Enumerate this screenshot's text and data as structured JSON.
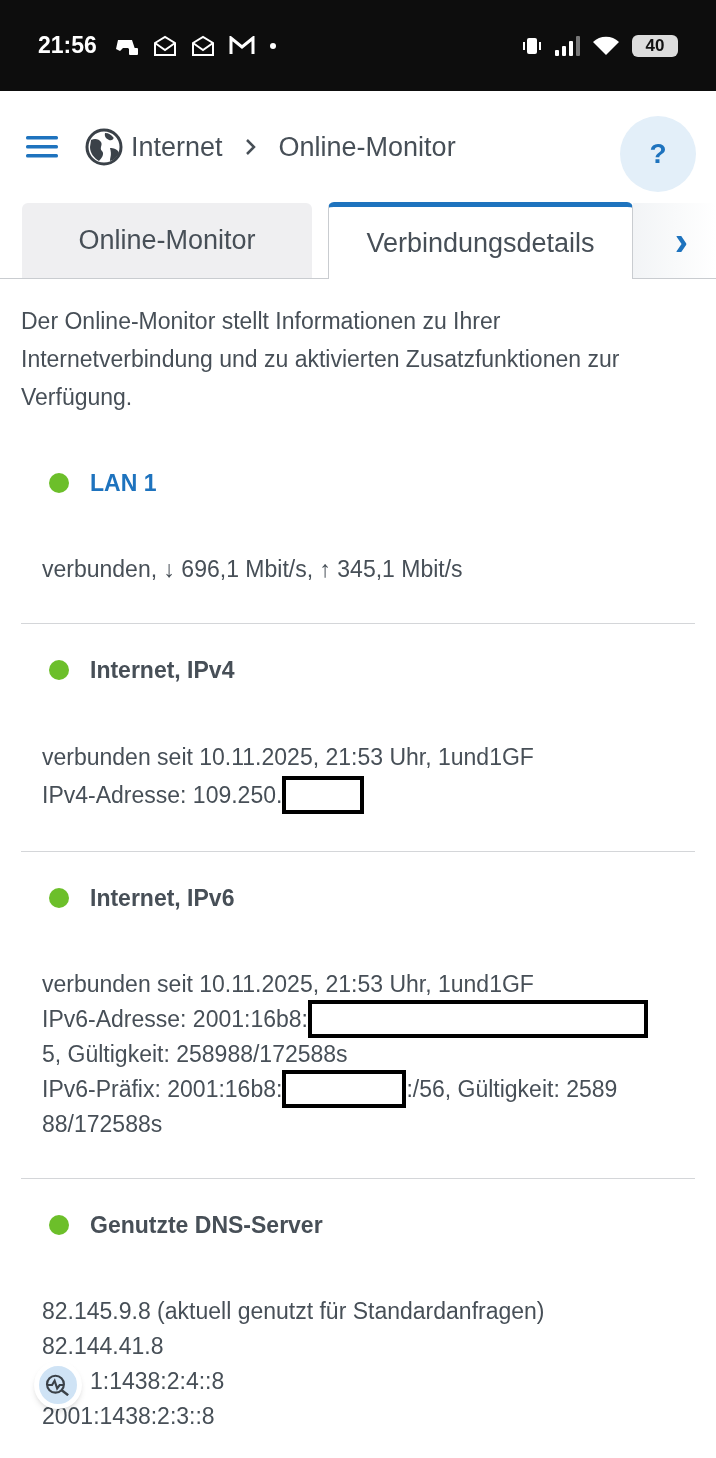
{
  "status_bar": {
    "time": "21:56",
    "battery": "40"
  },
  "header": {
    "breadcrumb": [
      "Internet",
      "Online-Monitor"
    ],
    "help": "?"
  },
  "tabs": [
    {
      "label": "Online-Monitor",
      "selected": false
    },
    {
      "label": "Verbindungsdetails",
      "selected": true
    }
  ],
  "tab_scroll": "›",
  "description": "Der Online-Monitor stellt Informationen zu Ihrer Internetverbindung und zu aktivierten Zusatzfunktionen zur Verfügung.",
  "sections": [
    {
      "title": "LAN 1",
      "kind": "link",
      "color": "#6cbf2a",
      "lines": [
        {
          "before": "verbunden, ↓ 696,1 Mbit/s, ↑ 345,1 Mbit/s"
        }
      ]
    },
    {
      "title": "Internet, IPv4",
      "kind": "heading",
      "color": "#6cbf2a",
      "lines": [
        {
          "before": "verbunden seit 10.11.2025, 21:53 Uhr, 1und1GF"
        },
        {
          "before": "IPv4-Adresse: 109.250.",
          "redacted": true
        }
      ]
    },
    {
      "title": "Internet, IPv6",
      "kind": "heading",
      "color": "#6cbf2a",
      "lines": [
        {
          "before": "verbunden seit 10.11.2025, 21:53 Uhr, 1und1GF"
        },
        {
          "before": "IPv6-Adresse: 2001:16b8:",
          "redacted": true
        },
        {
          "before": "5, Gültigkeit: 258988/172588s"
        },
        {
          "before": "IPv6-Präfix: 2001:16b8:",
          "redacted": true,
          "after": ":/56, Gültigkeit: 2589"
        },
        {
          "before": "88/172588s"
        }
      ]
    },
    {
      "title": "Genutzte DNS-Server",
      "kind": "heading",
      "color": "#6cbf2a",
      "lines": [
        {
          "before": "82.145.9.8 (aktuell genutzt für Standardanfragen)"
        },
        {
          "before": "82.144.41.8"
        },
        {
          "before": "1:1438:2:4::8",
          "covered": true
        },
        {
          "before": "2001:1438:2:3::8"
        }
      ]
    }
  ]
}
